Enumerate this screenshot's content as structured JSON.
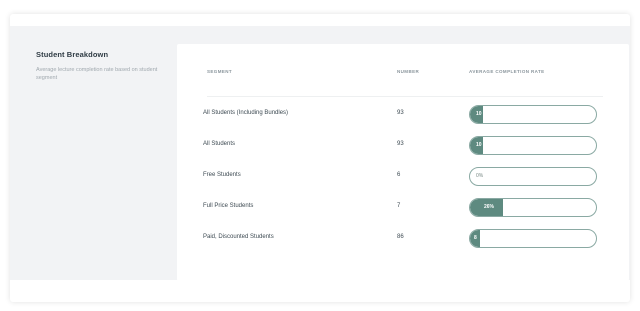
{
  "section": {
    "title": "Student Breakdown",
    "description": "Average lecture completion rate based on student segment"
  },
  "table": {
    "headers": {
      "segment": "SEGMENT",
      "number": "NUMBER",
      "rate": "AVERAGE COMPLETION RATE"
    },
    "rows": [
      {
        "segment": "All Students (Including Bundles)",
        "number": "93",
        "rate_label": "10",
        "rate": 0.1
      },
      {
        "segment": "All Students",
        "number": "93",
        "rate_label": "10",
        "rate": 0.1
      },
      {
        "segment": "Free Students",
        "number": "6",
        "rate_label": "0%",
        "rate": 0.0
      },
      {
        "segment": "Full Price Students",
        "number": "7",
        "rate_label": "26%",
        "rate": 0.26
      },
      {
        "segment": "Paid, Discounted Students",
        "number": "86",
        "rate_label": "8",
        "rate": 0.08
      }
    ]
  },
  "colors": {
    "bar_fill": "#5e8a80",
    "bar_border": "#8aa9a3",
    "page_bg": "#f2f3f5"
  }
}
